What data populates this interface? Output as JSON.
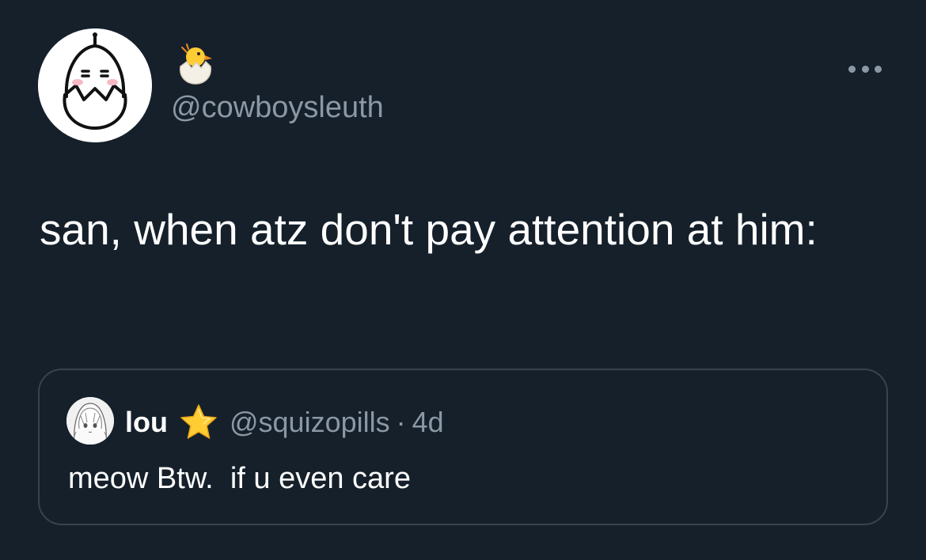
{
  "tweet": {
    "display_name_icon": "hatching-chick-emoji",
    "handle": "@cowboysleuth",
    "text": "san, when atz don't pay attention at him:",
    "more_icon": "more-options-icon"
  },
  "quoted_tweet": {
    "name": "lou",
    "name_badge_icon": "star-emoji",
    "handle": "@squizopills",
    "separator": "·",
    "time": "4d",
    "text": "meow Btw.  if u even care"
  },
  "colors": {
    "background": "#15202b",
    "primary_text": "#ffffff",
    "secondary_text": "#8b98a5",
    "border": "#38444d"
  }
}
